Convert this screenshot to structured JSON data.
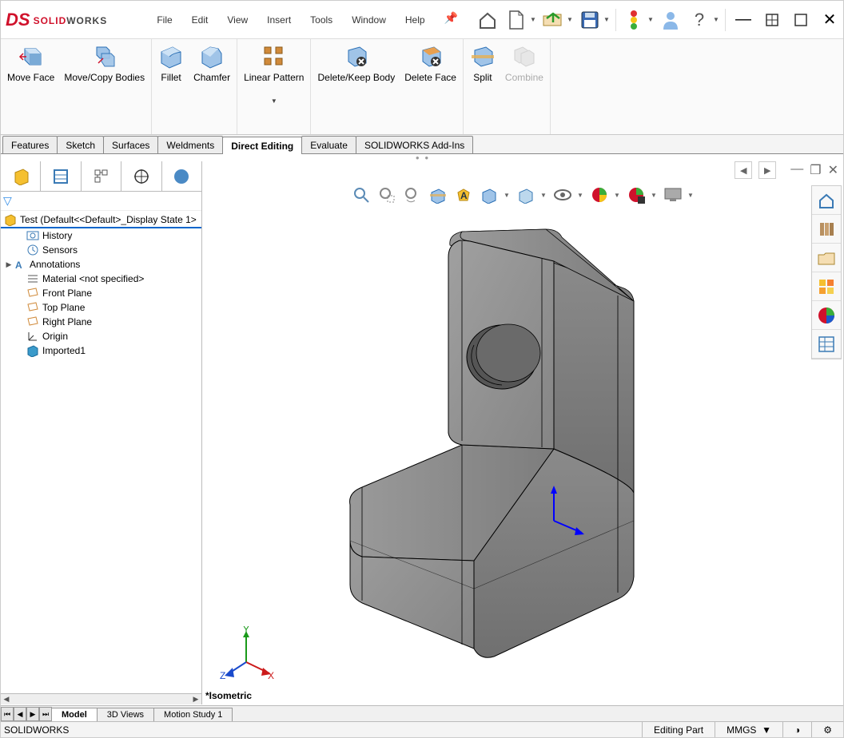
{
  "app": {
    "brand": "SOLID",
    "brand2": "WORKS"
  },
  "menus": [
    "File",
    "Edit",
    "View",
    "Insert",
    "Tools",
    "Window",
    "Help"
  ],
  "ribbon": {
    "tabs": [
      "Features",
      "Sketch",
      "Surfaces",
      "Weldments",
      "Direct Editing",
      "Evaluate",
      "SOLIDWORKS Add-Ins"
    ],
    "active_tab": "Direct Editing",
    "buttons": [
      {
        "name": "move-face",
        "label": "Move Face"
      },
      {
        "name": "move-copy-bodies",
        "label": "Move/Copy Bodies"
      },
      {
        "name": "fillet",
        "label": "Fillet"
      },
      {
        "name": "chamfer",
        "label": "Chamfer"
      },
      {
        "name": "linear-pattern",
        "label": "Linear Pattern",
        "dropdown": true
      },
      {
        "name": "delete-keep-body",
        "label": "Delete/Keep Body"
      },
      {
        "name": "delete-face",
        "label": "Delete Face"
      },
      {
        "name": "split",
        "label": "Split"
      },
      {
        "name": "combine",
        "label": "Combine",
        "disabled": true
      }
    ]
  },
  "tree": {
    "root": "Test  (Default<<Default>_Display State 1>",
    "items": [
      {
        "name": "history",
        "label": "History"
      },
      {
        "name": "sensors",
        "label": "Sensors"
      },
      {
        "name": "annotations",
        "label": "Annotations",
        "expandable": true
      },
      {
        "name": "material",
        "label": "Material <not specified>"
      },
      {
        "name": "front-plane",
        "label": "Front Plane"
      },
      {
        "name": "top-plane",
        "label": "Top Plane"
      },
      {
        "name": "right-plane",
        "label": "Right Plane"
      },
      {
        "name": "origin",
        "label": "Origin"
      },
      {
        "name": "imported1",
        "label": "Imported1"
      }
    ]
  },
  "triad": {
    "x": "X",
    "y": "Y",
    "z": "Z"
  },
  "viewport": {
    "view_label": "*Isometric"
  },
  "bottom_tabs": [
    "Model",
    "3D Views",
    "Motion Study 1"
  ],
  "status": {
    "left": "SOLIDWORKS",
    "mode": "Editing Part",
    "units": "MMGS"
  }
}
